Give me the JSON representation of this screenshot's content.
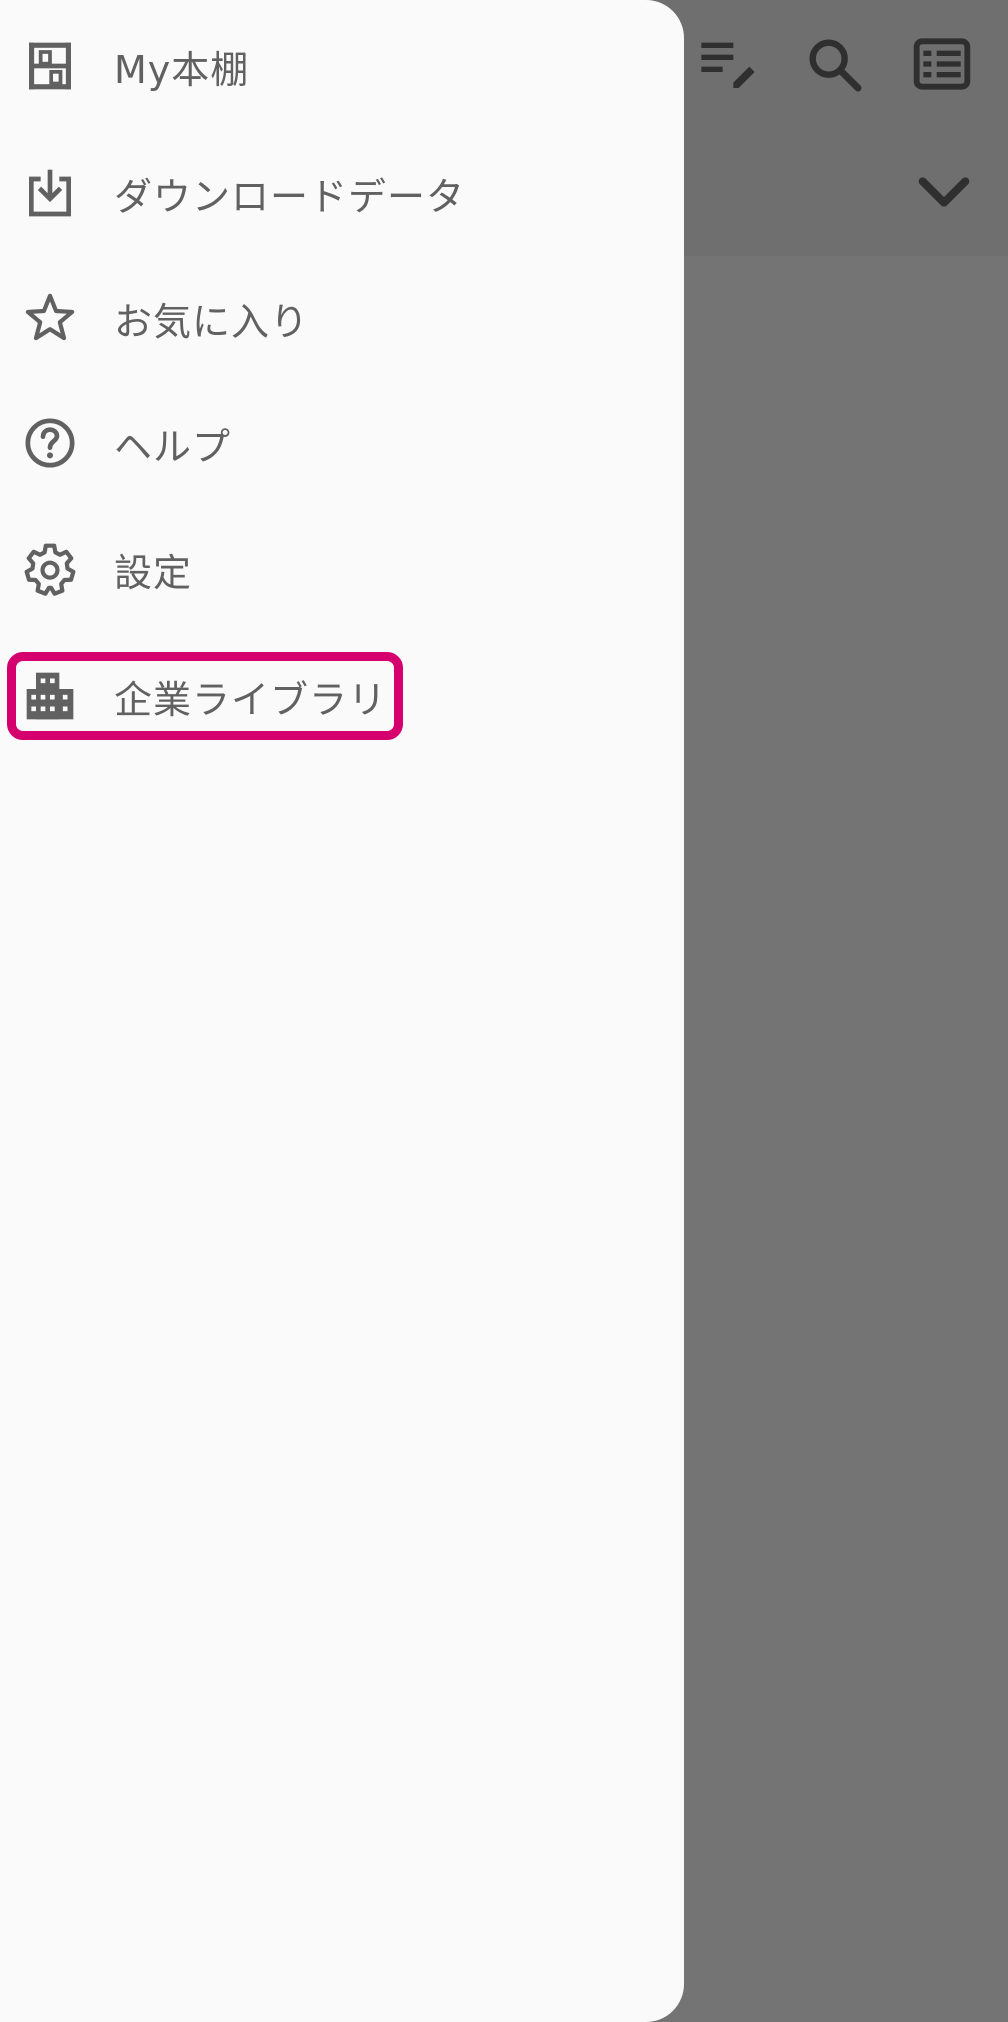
{
  "drawer": {
    "items": [
      {
        "label": "My本棚",
        "icon": "bookshelf-icon"
      },
      {
        "label": "ダウンロードデータ",
        "icon": "download-icon"
      },
      {
        "label": "お気に入り",
        "icon": "star-icon"
      },
      {
        "label": "ヘルプ",
        "icon": "help-icon"
      },
      {
        "label": "設定",
        "icon": "gear-icon"
      },
      {
        "label": "企業ライブラリ",
        "icon": "building-icon"
      }
    ]
  },
  "toolbar": {
    "icons": [
      "edit-list-icon",
      "search-icon",
      "list-view-icon",
      "chevron-down-icon"
    ]
  },
  "colors": {
    "drawer_bg": "#fafafa",
    "scrim": "#747474",
    "icon": "#616161",
    "highlight": "#d5006d"
  }
}
